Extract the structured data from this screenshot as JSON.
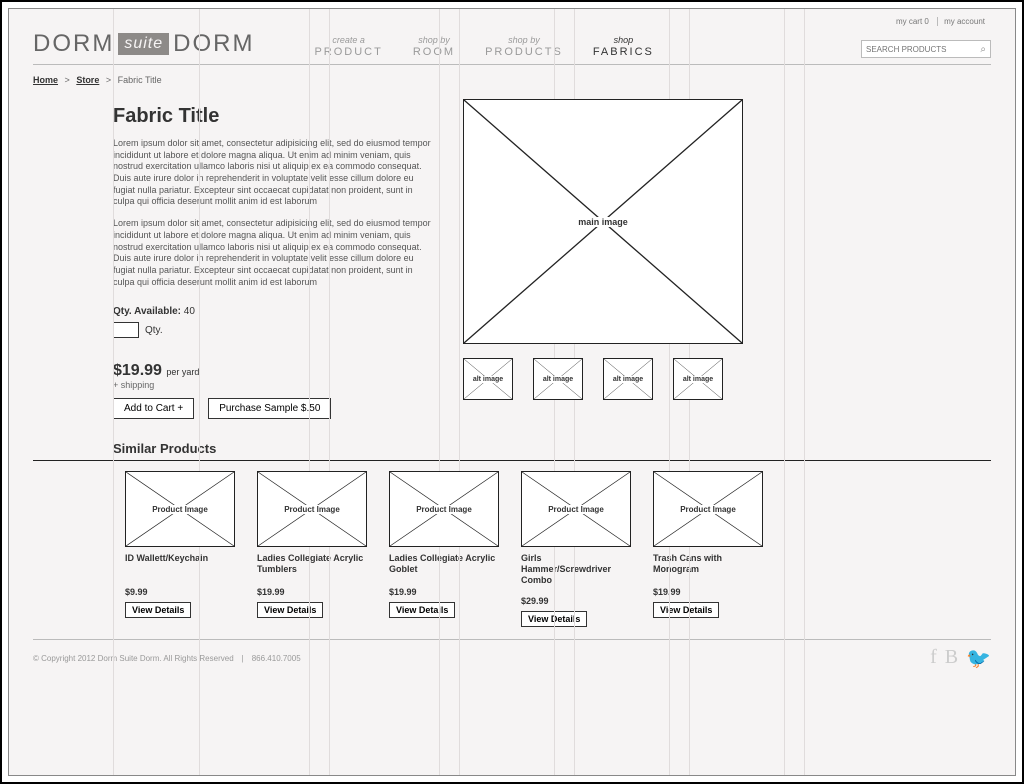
{
  "topbar": {
    "cart": "my cart 0",
    "account": "my account"
  },
  "logo": {
    "w1": "Dorm",
    "mid": "suite",
    "w2": "Dorm"
  },
  "nav": [
    {
      "l1": "create a",
      "l2": "PRODUCT"
    },
    {
      "l1": "shop by",
      "l2": "ROOM"
    },
    {
      "l1": "shop by",
      "l2": "PRODUCTS"
    },
    {
      "l1": "shop",
      "l2": "FABRICS"
    }
  ],
  "search": {
    "placeholder": "SEARCH PRODUCTS"
  },
  "breadcrumb": {
    "home": "Home",
    "store": "Store",
    "current": "Fabric Title",
    "sep": ">"
  },
  "product": {
    "title": "Fabric Title",
    "p1": "Lorem ipsum dolor sit amet, consectetur adipisicing elit, sed do eiusmod tempor incididunt ut labore et dolore magna aliqua. Ut enim ad minim veniam, quis nostrud exercitation ullamco laboris nisi ut aliquip ex ea commodo consequat. Duis aute irure dolor in reprehenderit in voluptate velit esse cillum dolore eu fugiat nulla pariatur. Excepteur sint occaecat cupidatat non proident, sunt in culpa qui officia deserunt mollit anim id est laborum",
    "p2": "Lorem ipsum dolor sit amet, consectetur adipisicing elit, sed do eiusmod tempor incididunt ut labore et dolore magna aliqua. Ut enim ad minim veniam, quis nostrud exercitation ullamco laboris nisi ut aliquip ex ea commodo consequat. Duis aute irure dolor in reprehenderit in voluptate velit esse cillum dolore eu fugiat nulla pariatur. Excepteur sint occaecat cupidatat non proident, sunt in culpa qui officia deserunt mollit anim id est laborum",
    "qty_label": "Qty. Available:",
    "qty_value": "40",
    "qty_field_label": "Qty.",
    "price": "$19.99",
    "per": "per yard",
    "shipping": "+ shipping",
    "add_btn": "Add to Cart +",
    "sample_btn": "Purchase Sample $.50",
    "main_image": "main image",
    "alt_image": "alt image"
  },
  "similar": {
    "title": "Similar Products",
    "img_label": "Product Image",
    "view": "View Details",
    "items": [
      {
        "name": "ID Wallett/Keychain",
        "price": "$9.99"
      },
      {
        "name": "Ladies Collegiate Acrylic Tumblers",
        "price": "$19.99"
      },
      {
        "name": "Ladies Collegiate Acrylic Goblet",
        "price": "$19.99"
      },
      {
        "name": "Girls Hammer/Screwdriver Combo",
        "price": "$29.99"
      },
      {
        "name": "Trash Cans with Monogram",
        "price": "$19.99"
      }
    ]
  },
  "footer": {
    "copy": "© Copyright 2012 Dorm Suite Dorm.  All Rights Reserved",
    "phone": "866.410.7005"
  }
}
